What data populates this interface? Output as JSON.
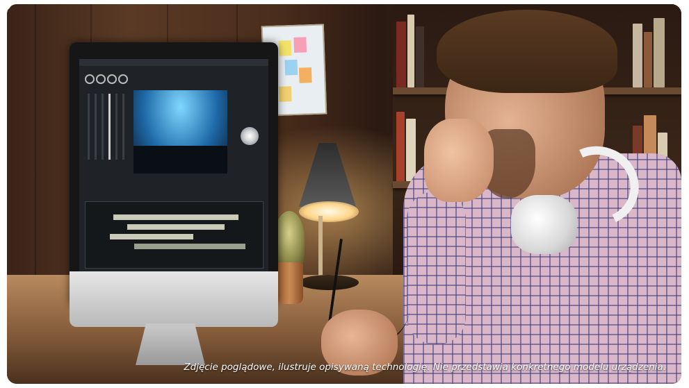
{
  "image": {
    "caption": "Zdjęcie poglądowe, ilustruje opisywaną technologię. Nie przedstawia konkretnego modelu urządzenia."
  },
  "colors": {
    "wall_wood": "#4a2d1c",
    "lamp_glow": "#ffd58a",
    "shirt": "#d9b6c8",
    "screen_preview": "#1e6aa8"
  }
}
